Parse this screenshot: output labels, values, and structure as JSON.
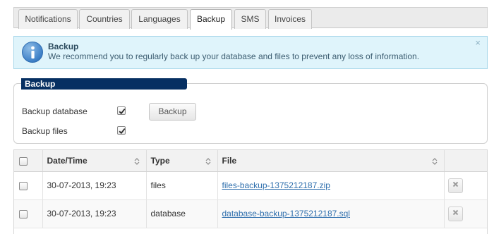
{
  "tabs": [
    {
      "label": "Notifications",
      "active": false
    },
    {
      "label": "Countries",
      "active": false
    },
    {
      "label": "Languages",
      "active": false
    },
    {
      "label": "Backup",
      "active": true
    },
    {
      "label": "SMS",
      "active": false
    },
    {
      "label": "Invoices",
      "active": false
    }
  ],
  "alert": {
    "icon": "info-icon",
    "title": "Backup",
    "message": "We recommend you to regularly back up your database and files to prevent any loss of information.",
    "close": "×"
  },
  "backup_panel": {
    "title": "Backup",
    "database_label": "Backup database",
    "database_checked": true,
    "files_label": "Backup files",
    "files_checked": true,
    "button_label": "Backup"
  },
  "table": {
    "columns": [
      "Date/Time",
      "Type",
      "File"
    ],
    "rows": [
      {
        "datetime": "30-07-2013, 19:23",
        "type": "files",
        "file": "files-backup-1375212187.zip"
      },
      {
        "datetime": "30-07-2013, 19:23",
        "type": "database",
        "file": "database-backup-1375212187.sql"
      }
    ]
  },
  "colors": {
    "panel_title_bg": "#062f62",
    "alert_bg": "#dff4fb",
    "link": "#2f6fad"
  }
}
